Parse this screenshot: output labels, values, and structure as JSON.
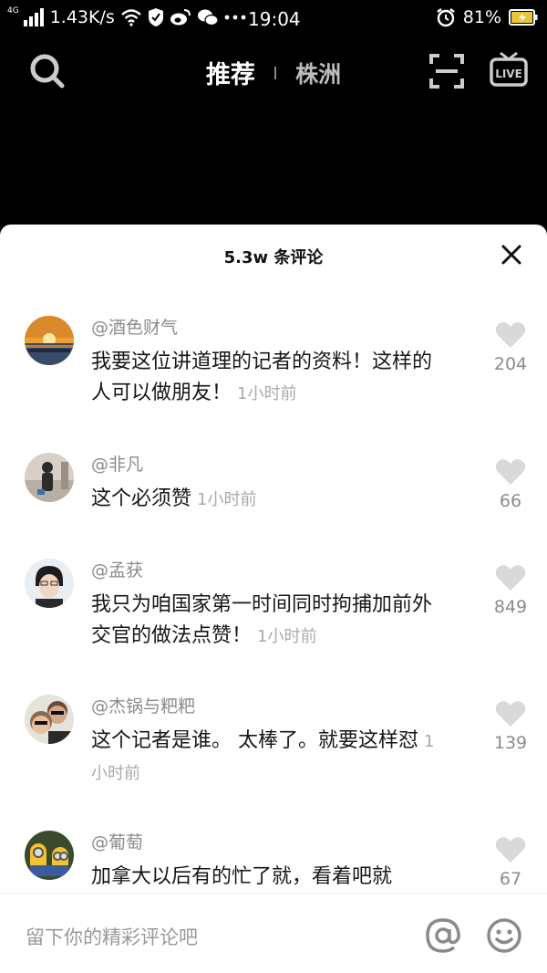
{
  "status_bar": {
    "network_type": "4G",
    "speed": "1.43K/s",
    "time": "19:04",
    "battery": "81%",
    "icons": [
      "signal-icon",
      "wifi-icon",
      "shield-icon",
      "weibo-icon",
      "wechat-icon",
      "more-dots-icon",
      "alarm-icon",
      "battery-icon"
    ]
  },
  "nav": {
    "tab_active": "推荐",
    "tab_location": "株洲",
    "icons": [
      "search-icon",
      "scan-icon",
      "live-icon"
    ]
  },
  "comments_panel": {
    "title": "5.3w 条评论",
    "comments": [
      {
        "user": "@酒色财气",
        "text": "我要这位讲道理的记者的资料！这样的人可以做朋友！",
        "time": "1小时前",
        "likes": "204"
      },
      {
        "user": "@非凡",
        "text": "这个必须赞",
        "time": "1小时前",
        "likes": "66"
      },
      {
        "user": "@孟获",
        "text": "我只为咱国家第一时间同时拘捕加前外交官的做法点赞！",
        "time": "1小时前",
        "likes": "849"
      },
      {
        "user": "@杰锅与粑粑",
        "text": "这个记者是谁。 太棒了。就要这样怼",
        "time": "1小时前",
        "likes": "139"
      },
      {
        "user": "@葡萄",
        "text": "加拿大以后有的忙了就，看着吧就",
        "time": "",
        "likes": "67"
      }
    ]
  },
  "input": {
    "placeholder": "留下你的精彩评论吧"
  },
  "colors": {
    "accent_dark": "#000000",
    "sheet_bg": "#ffffff",
    "muted_text": "#8b8b8b"
  }
}
